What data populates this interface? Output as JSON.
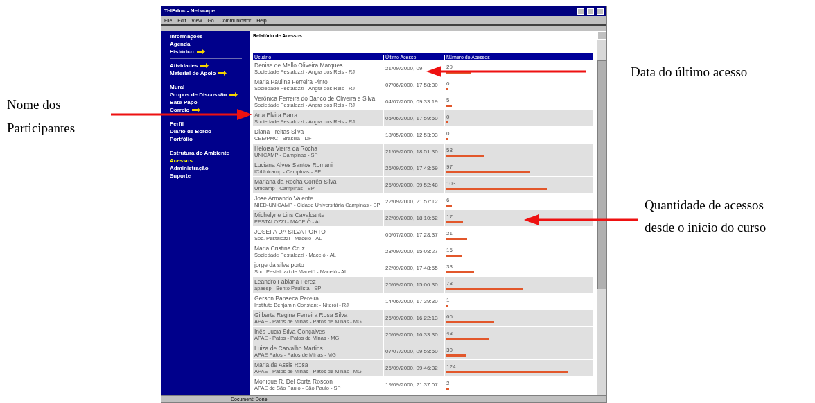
{
  "annotations": {
    "participants": "Nome dos Participantes",
    "last_access": "Data do último acesso",
    "count": "Quantidade de acessos desde o início do curso"
  },
  "window": {
    "title": "TelEduc - Netscape",
    "menu": [
      "File",
      "Edit",
      "View",
      "Go",
      "Communicator",
      "Help"
    ],
    "status_bar": "Document: Done"
  },
  "sidebar": {
    "groups": [
      [
        {
          "label": "Informações",
          "pointer": false,
          "selected": false
        },
        {
          "label": "Agenda",
          "pointer": false,
          "selected": false
        },
        {
          "label": "Histórico",
          "pointer": true,
          "selected": false
        }
      ],
      [
        {
          "label": "Atividades",
          "pointer": true,
          "selected": false
        },
        {
          "label": "Material de Apoio",
          "pointer": true,
          "selected": false
        }
      ],
      [
        {
          "label": "Mural",
          "pointer": false,
          "selected": false
        },
        {
          "label": "Grupos de Discussão",
          "pointer": true,
          "selected": false
        },
        {
          "label": "Bate-Papo",
          "pointer": false,
          "selected": false
        },
        {
          "label": "Correio",
          "pointer": true,
          "selected": false
        }
      ],
      [
        {
          "label": "Perfil",
          "pointer": false,
          "selected": false
        },
        {
          "label": "Diário de Bordo",
          "pointer": false,
          "selected": false
        },
        {
          "label": "Portfólio",
          "pointer": false,
          "selected": false
        }
      ],
      [
        {
          "label": "Estrutura do Ambiente",
          "pointer": false,
          "selected": false
        },
        {
          "label": "Acessos",
          "pointer": false,
          "selected": true
        },
        {
          "label": "Administração",
          "pointer": false,
          "selected": false
        },
        {
          "label": "Suporte",
          "pointer": false,
          "selected": false
        }
      ]
    ]
  },
  "report": {
    "heading": "Relatório de Acessos",
    "columns": [
      "Usuário",
      "Último Acesso",
      "Número de Acessos"
    ],
    "rows": [
      {
        "name": "Denise de Mello Oliveira Marques",
        "institution": "Sociedade Pestalozzi - Angra dos Reis - RJ",
        "last_access": "21/09/2000, 09",
        "count": "29",
        "level": 0.18,
        "shaded": false
      },
      {
        "name": "Maria Paulina Ferreira Pinto",
        "institution": "Sociedade Pestalozzi - Angra dos Reis - RJ",
        "last_access": "07/06/2000, 17:58:30",
        "count": "0",
        "level": 0.01,
        "shaded": false
      },
      {
        "name": "Verônica Ferreira do Banco de Oliveira e Silva",
        "institution": "Sociedade Pestalozzi - Angra dos Reis - RJ",
        "last_access": "04/07/2000, 09:33:19",
        "count": "5",
        "level": 0.04,
        "shaded": false
      },
      {
        "name": "Ana Elvira Barra",
        "institution": "Sociedade Pestalozzi - Angra dos Reis - RJ",
        "last_access": "05/06/2000, 17:59:50",
        "count": "0",
        "level": 0.01,
        "shaded": true
      },
      {
        "name": "Diana Freitas Silva",
        "institution": "CEE/PMC - Brasília - DF",
        "last_access": "18/05/2000, 12:53:03",
        "count": "0",
        "level": 0.01,
        "shaded": false
      },
      {
        "name": "Heloisa Vieira da Rocha",
        "institution": "UNICAMP - Campinas - SP",
        "last_access": "21/09/2000, 18:51:30",
        "count": "58",
        "level": 0.27,
        "shaded": true
      },
      {
        "name": "Luciana Alves Santos Romani",
        "institution": "IC/Unicamp - Campinas - SP",
        "last_access": "26/09/2000, 17:48:59",
        "count": "97",
        "level": 0.6,
        "shaded": true
      },
      {
        "name": "Mariana da Rocha Corrêa Silva",
        "institution": "Unicamp - Campinas - SP",
        "last_access": "26/09/2000, 09:52:48",
        "count": "103",
        "level": 0.72,
        "shaded": true
      },
      {
        "name": "José Armando Valente",
        "institution": "NIED-UNICAMP - Cidade Universitária Campinas - SP",
        "last_access": "22/09/2000, 21:57:12",
        "count": "6",
        "level": 0.04,
        "shaded": false
      },
      {
        "name": "Michelyne Lins Cavalcante",
        "institution": "PESTALOZZI - MACEIÓ - AL",
        "last_access": "22/09/2000, 18:10:52",
        "count": "17",
        "level": 0.12,
        "shaded": true
      },
      {
        "name": "JOSEFA DA SILVA PORTO",
        "institution": "Soc. Pestalozzi - Maceió - AL",
        "last_access": "05/07/2000, 17:28:37",
        "count": "21",
        "level": 0.15,
        "shaded": false
      },
      {
        "name": "Maria Cristina Cruz",
        "institution": "Sociedade Pestalozzi - Maceió - AL",
        "last_access": "28/09/2000, 15:08:27",
        "count": "16",
        "level": 0.11,
        "shaded": false
      },
      {
        "name": "jorge da silva porto",
        "institution": "Soc. Pestalozzi de Maceió - Maceió - AL",
        "last_access": "22/09/2000, 17:48:55",
        "count": "33",
        "level": 0.2,
        "shaded": false
      },
      {
        "name": "Leandro Fabiana Perez",
        "institution": "apaesp - Bento Paulista - SP",
        "last_access": "26/09/2000, 15:06:30",
        "count": "78",
        "level": 0.55,
        "shaded": true
      },
      {
        "name": "Gerson Panseca Pereira",
        "institution": "Instituto Benjamin Constant - Niterói - RJ",
        "last_access": "14/06/2000, 17:39:30",
        "count": "1",
        "level": 0.01,
        "shaded": false
      },
      {
        "name": "Gilberta Regina Ferreira Rosa Silva",
        "institution": "APAE - Patos de Minas - Patos de Minas - MG",
        "last_access": "26/09/2000, 16:22:13",
        "count": "66",
        "level": 0.34,
        "shaded": true
      },
      {
        "name": "Inês Lúcia Silva Gonçalves",
        "institution": "APAE - Patos - Patos de Minas - MG",
        "last_access": "26/09/2000, 16:33:30",
        "count": "43",
        "level": 0.3,
        "shaded": true
      },
      {
        "name": "Luiza de Carvalho Martins",
        "institution": "APAE Patos - Patos de Minas - MG",
        "last_access": "07/07/2000, 09:58:50",
        "count": "30",
        "level": 0.14,
        "shaded": true
      },
      {
        "name": "Maria de Assis Rosa",
        "institution": "APAE - Patos de Minas - Patos de Minas - MG",
        "last_access": "26/09/2000, 09:46:32",
        "count": "124",
        "level": 0.87,
        "shaded": true
      },
      {
        "name": "Monique R. Del Corta Roscon",
        "institution": "APAE de São Paulo - São Paulo - SP",
        "last_access": "19/09/2000, 21:37:07",
        "count": "2",
        "level": 0.02,
        "shaded": false
      }
    ]
  }
}
